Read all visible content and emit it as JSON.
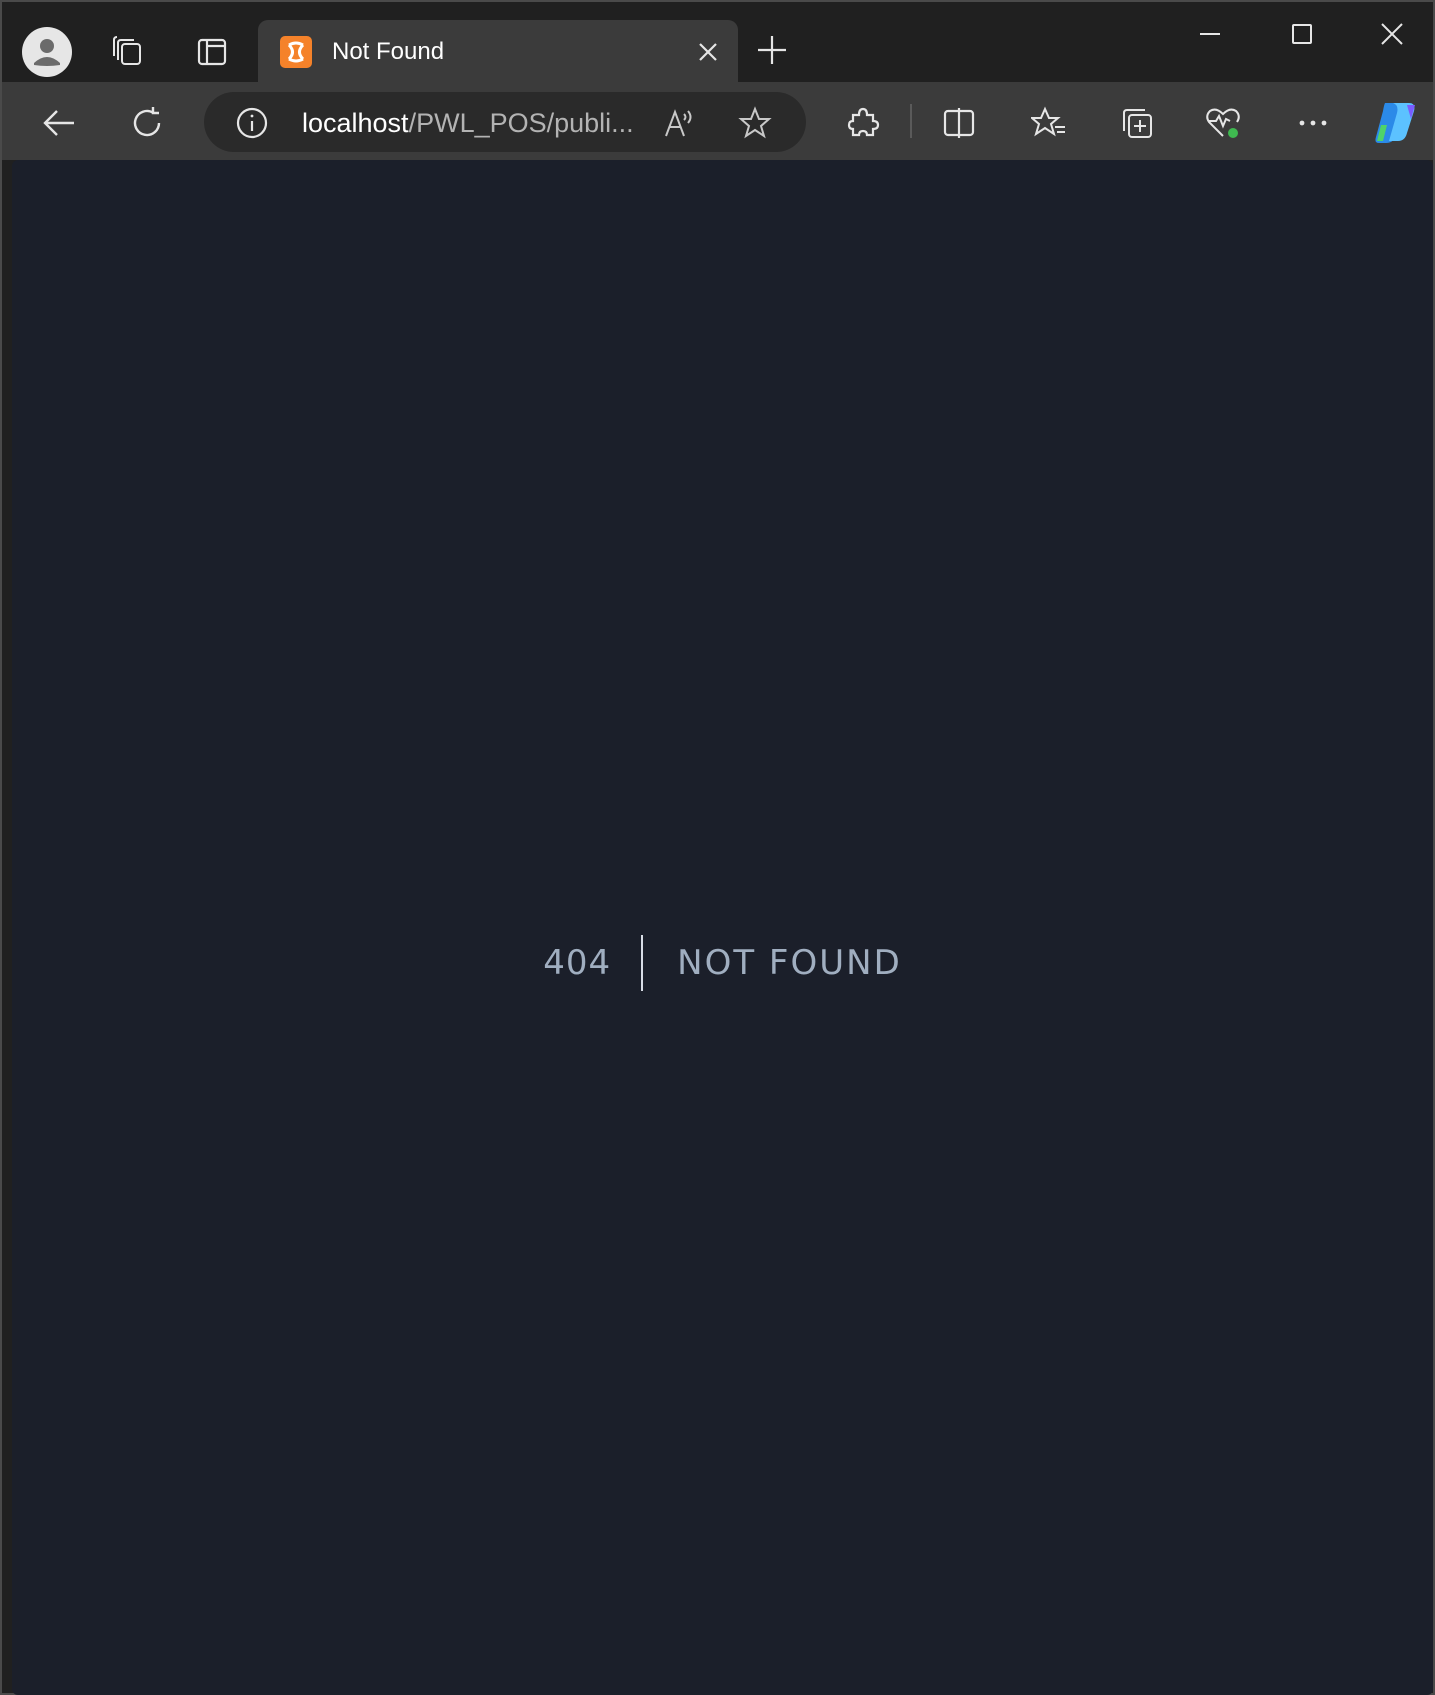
{
  "browser": {
    "tab": {
      "title": "Not Found",
      "favicon": "xampp-icon"
    },
    "address": {
      "host": "localhost",
      "path": "/PWL_POS/publi..."
    },
    "icons": {
      "profile": "profile-icon",
      "workspaces": "workspaces-icon",
      "tab_actions": "vertical-tabs-icon",
      "new_tab": "plus-icon",
      "minimize": "minimize-icon",
      "maximize": "maximize-icon",
      "close": "close-icon",
      "back": "back-arrow-icon",
      "refresh": "refresh-icon",
      "info": "info-icon",
      "read_aloud": "read-aloud-icon",
      "favorite": "star-icon",
      "extensions": "extensions-icon",
      "split_screen": "split-screen-icon",
      "favorites": "favorites-icon",
      "collections": "collections-icon",
      "browser_essentials": "heartbeat-icon",
      "more": "more-icon",
      "copilot": "copilot-icon"
    },
    "colors": {
      "frame": "#202020",
      "toolbar": "#3b3b3b",
      "page_bg": "#1b1f2a",
      "text_muted": "#a0aec0",
      "accent": "#f5822a"
    }
  },
  "page": {
    "error_code": "404",
    "error_message": "NOT FOUND"
  }
}
